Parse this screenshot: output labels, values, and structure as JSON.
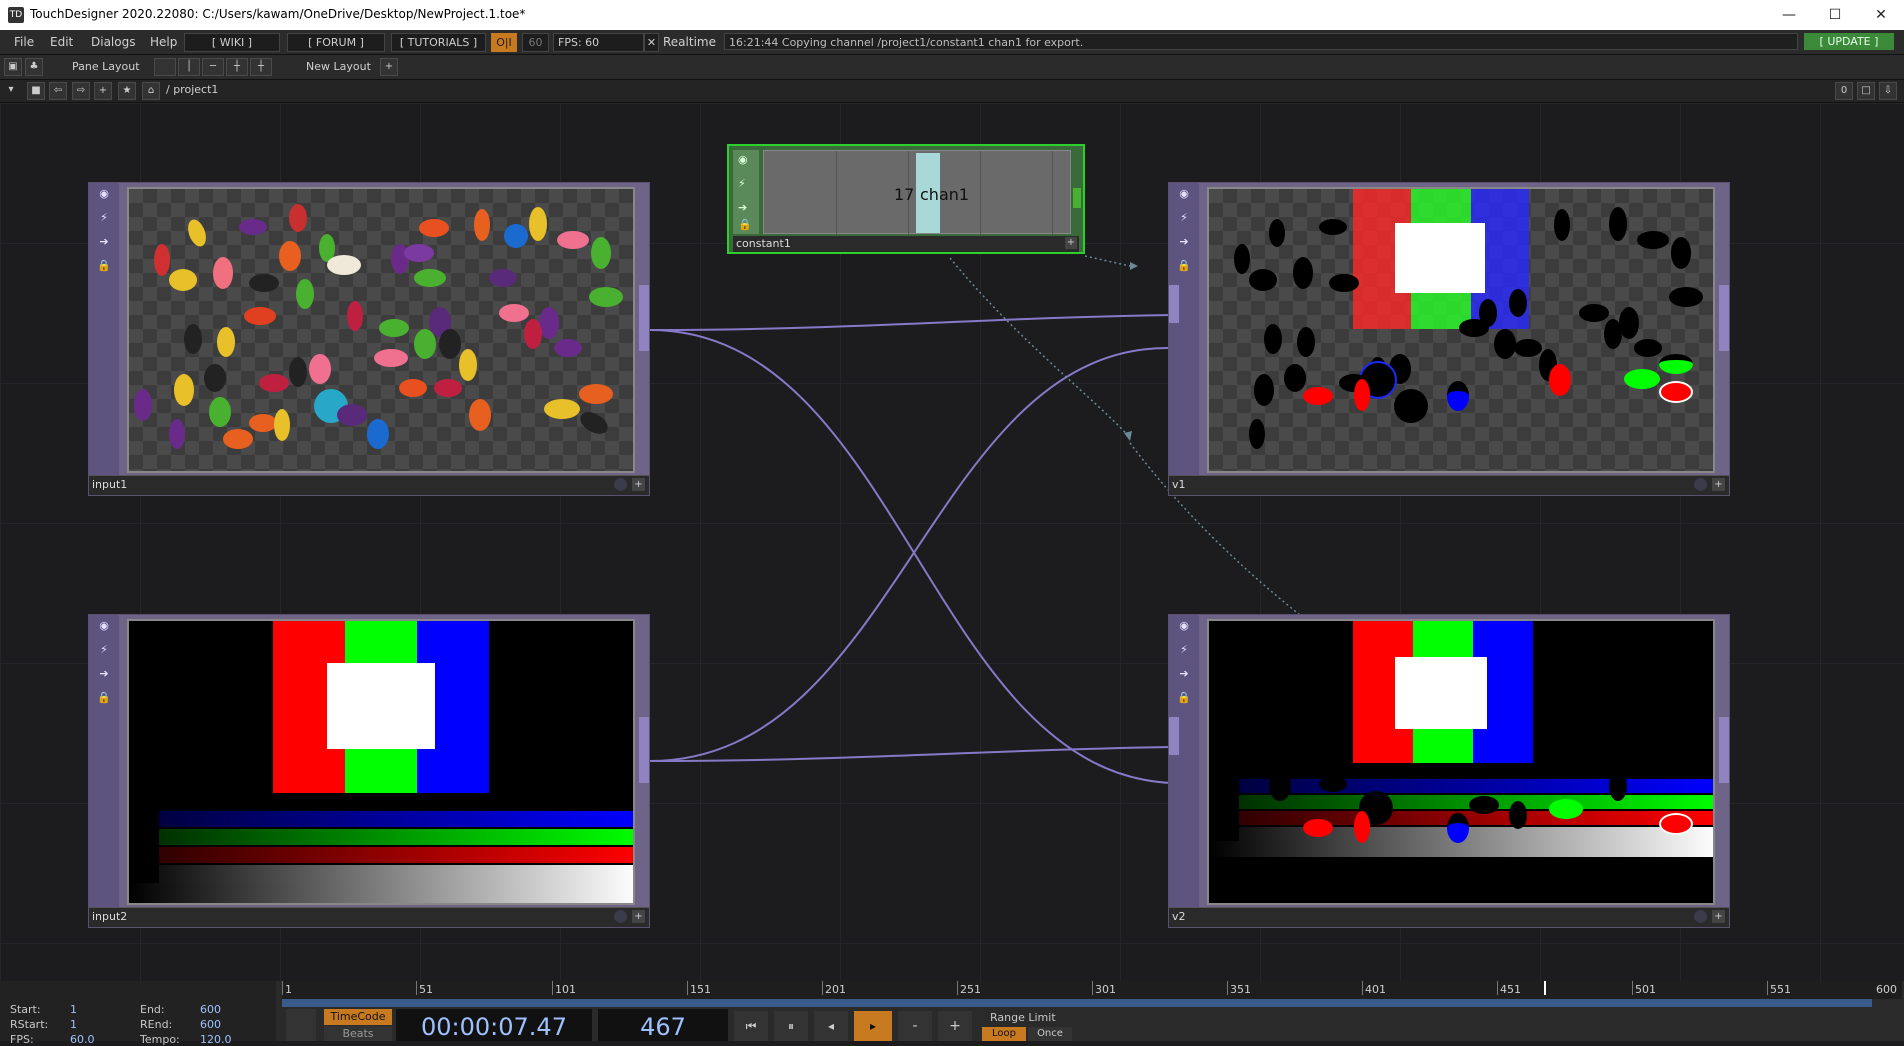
{
  "window": {
    "title": "TouchDesigner 2020.22080: C:/Users/kawam/OneDrive/Desktop/NewProject.1.toe*",
    "minimize": "—",
    "maximize": "☐",
    "close": "✕"
  },
  "menubar": {
    "menus": [
      "File",
      "Edit",
      "Dialogs",
      "Help"
    ],
    "wiki": "[ WIKI ]",
    "forum": "[ FORUM ]",
    "tutorials": "[ TUTORIALS ]",
    "oi": "O|I",
    "fps_target": "60",
    "fps": "FPS: 60",
    "realtime_mark": "✕",
    "realtime": "Realtime",
    "status": "16:21:44 Copying channel /project1/constant1 chan1 for export.",
    "update": "[ UPDATE ]"
  },
  "panebar": {
    "pane_layout": "Pane Layout",
    "new_layout": "New Layout",
    "add": "+"
  },
  "pathbar": {
    "path": "/ project1",
    "count": "0"
  },
  "nodes": {
    "input1": {
      "name": "input1"
    },
    "input2": {
      "name": "input2"
    },
    "v1": {
      "name": "v1"
    },
    "v2": {
      "name": "v2"
    },
    "constant1": {
      "name": "constant1",
      "value": "17",
      "channel": "chan1"
    }
  },
  "timeline": {
    "ruler": [
      "1",
      "51",
      "101",
      "151",
      "201",
      "251",
      "301",
      "351",
      "401",
      "451",
      "501",
      "551",
      "600"
    ],
    "start_label": "Start:",
    "start": "1",
    "end_label": "End:",
    "end": "600",
    "rstart_label": "RStart:",
    "rstart": "1",
    "rend_label": "REnd:",
    "rend": "600",
    "fps_label": "FPS:",
    "fps": "60.0",
    "tempo_label": "Tempo:",
    "tempo": "120.0",
    "timecode": "TimeCode",
    "beats": "Beats",
    "time": "00:00:07.47",
    "frame": "467",
    "range_limit": "Range Limit",
    "loop": "Loop",
    "once": "Once",
    "minus": "-",
    "plus": "+"
  },
  "colors": {
    "node": "#6e6488",
    "constant_border": "#2ccf2c",
    "wire": "#8878c8",
    "update": "#3a8a3a"
  }
}
